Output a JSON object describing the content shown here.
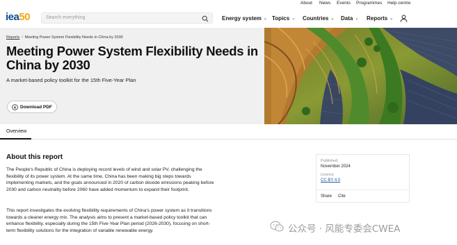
{
  "utility_bar": [
    "About",
    "News",
    "Events",
    "Programmes",
    "Help centre"
  ],
  "logo": {
    "iea": "iea",
    "fifty": "50"
  },
  "search": {
    "placeholder": "Search everything"
  },
  "nav": [
    "Energy system",
    "Topics",
    "Countries",
    "Data",
    "Reports"
  ],
  "breadcrumb": {
    "root": "Reports",
    "separator": "/",
    "current": "Meeting Power System Flexibility Needs in China by 2030"
  },
  "hero": {
    "title": "Meeting Power System Flexibility Needs in China by 2030",
    "subtitle": "A market-based policy toolkit for the 15th Five-Year Plan",
    "download_label": "Download PDF"
  },
  "tabs": {
    "overview": "Overview"
  },
  "about": {
    "heading": "About this report",
    "paragraphs": [
      "The People's Republic of China is deploying record levels of wind and solar PV, challenging the flexibility of its power system. At the same time, China has been making big steps towards implementing markets, and the goals announced in 2020 of carbon dioxide emissions peaking before 2030 and carbon neutrality before 2060 have added momentum to expand their footprint.",
      "This report investigates the evolving flexibility requirements of China's power system as it transitions towards a cleaner energy mix. The analysis aims to present a market-based policy toolkit that can enhance flexibility, especially during the 15th Five-Year Plan period (2026-2030), focusing on short-term flexibility solutions for the integration of variable renewable energy."
    ]
  },
  "meta": {
    "published_label": "Published",
    "published_value": "November 2024",
    "licence_label": "Licence",
    "licence_value": "CC BY 4.0",
    "share": "Share",
    "cite": "Cite"
  },
  "watermark": "公众号 · 风能专委会CWEA",
  "colors": {
    "brand_blue": "#0d4a8f",
    "brand_orange": "#f3a712",
    "link_blue": "#1a57a8",
    "hero_bg": "#f0f0f0"
  }
}
